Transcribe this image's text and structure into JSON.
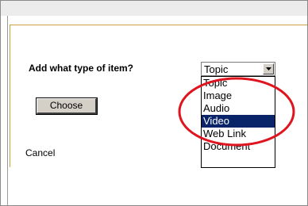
{
  "dialog": {
    "prompt": "Add what type of item?",
    "choose_label": "Choose",
    "cancel_label": "Cancel"
  },
  "item_type_select": {
    "selected_value": "Topic",
    "options": [
      {
        "label": "Topic",
        "highlighted": false
      },
      {
        "label": "Image",
        "highlighted": false
      },
      {
        "label": "Audio",
        "highlighted": false
      },
      {
        "label": "Video",
        "highlighted": true
      },
      {
        "label": "Web Link",
        "highlighted": false
      },
      {
        "label": "Document",
        "highlighted": false
      }
    ]
  },
  "annotation": {
    "color": "#e0141e",
    "shape": "ellipse"
  },
  "colors": {
    "selection_bg": "#0a246a",
    "dialog_border": "#c8a040",
    "button_face": "#d4d0c8"
  }
}
